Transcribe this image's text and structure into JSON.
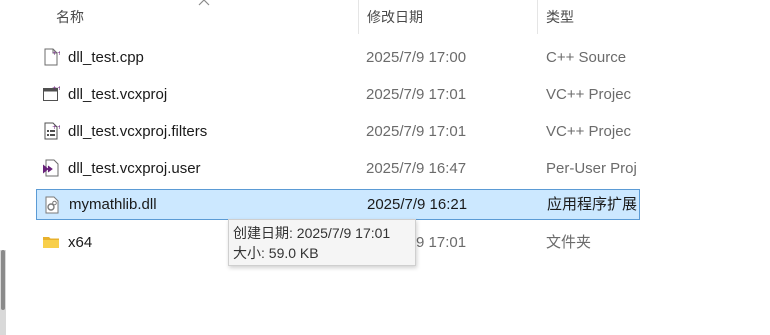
{
  "header": {
    "name_label": "名称",
    "date_label": "修改日期",
    "type_label": "类型"
  },
  "files": [
    {
      "name": "dll_test.cpp",
      "date": "2025/7/9 17:00",
      "type": "C++ Source",
      "icon": "cpp-file-icon"
    },
    {
      "name": "dll_test.vcxproj",
      "date": "2025/7/9 17:01",
      "type": "VC++ Projec",
      "icon": "vcxproj-file-icon"
    },
    {
      "name": "dll_test.vcxproj.filters",
      "date": "2025/7/9 17:01",
      "type": "VC++ Projec",
      "icon": "filters-file-icon"
    },
    {
      "name": "dll_test.vcxproj.user",
      "date": "2025/7/9 16:47",
      "type": "Per-User Proj",
      "icon": "user-file-icon"
    },
    {
      "name": "mymathlib.dll",
      "date": "2025/7/9 16:21",
      "type": "应用程序扩展",
      "icon": "dll-file-icon",
      "selected": true
    },
    {
      "name": "x64",
      "date": "2025/7/9 17:01",
      "type": "文件夹",
      "icon": "folder-icon"
    }
  ],
  "tooltip": {
    "created": "创建日期: 2025/7/9 17:01",
    "size": "大小: 59.0 KB"
  },
  "colors": {
    "selection_bg": "#cce8ff",
    "selection_border": "#5b9bd5",
    "folder": "#f4c430",
    "vs_purple": "#68217a"
  }
}
